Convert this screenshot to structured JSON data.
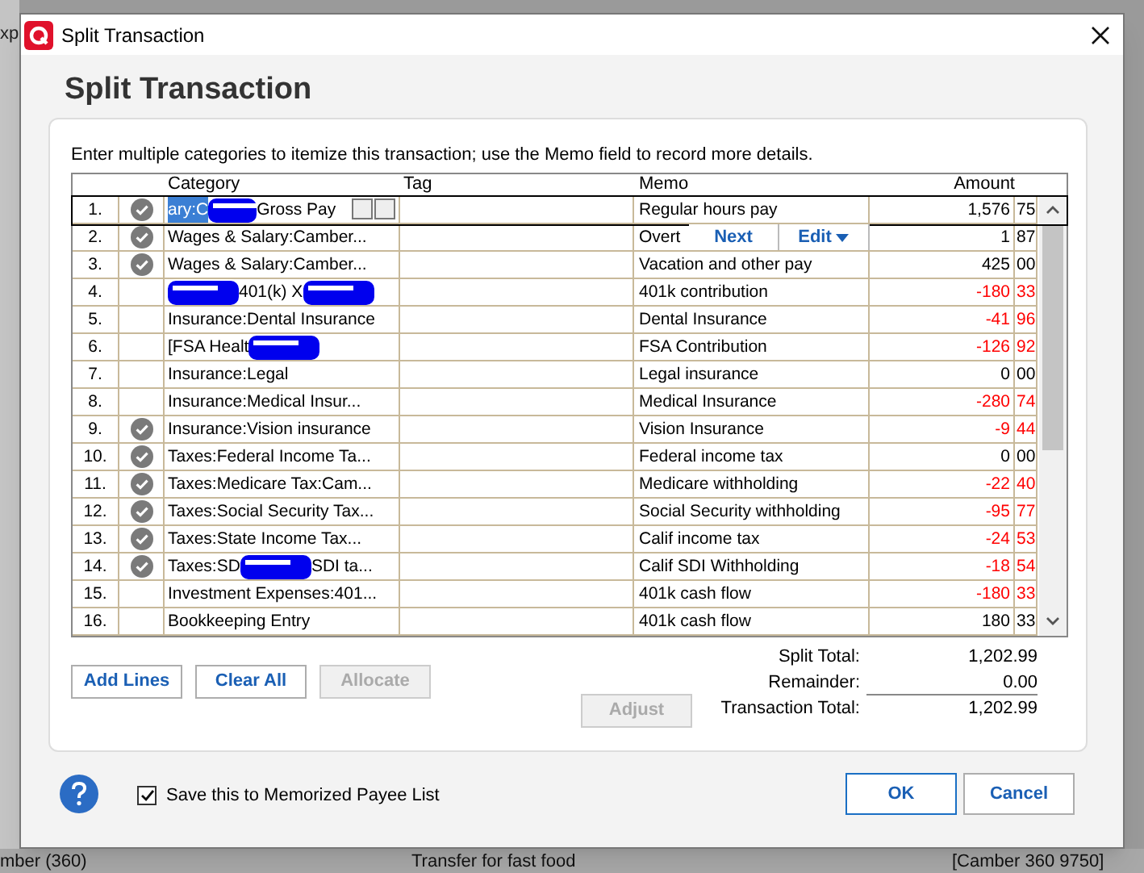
{
  "background": {
    "top_left_text": "xp",
    "bottom_row": [
      "mber (360)",
      "Transfer for fast food",
      "[Camber 360 9750]"
    ]
  },
  "window": {
    "title": "Split Transaction"
  },
  "heading": "Split Transaction",
  "instructions": "Enter multiple categories to itemize this transaction; use the Memo field to record more details.",
  "table": {
    "columns": [
      "Category",
      "Tag",
      "Memo",
      "Amount"
    ],
    "rows": [
      {
        "number": "1.",
        "cleared": true,
        "selected": true,
        "category": [
          {
            "kind": "text",
            "text": "ary:C"
          },
          {
            "kind": "redacted"
          },
          {
            "kind": "text",
            "text": "Gross Pay"
          }
        ],
        "memo": "Regular hours pay",
        "dollars": "1,576",
        "cents": "75",
        "negative": false
      },
      {
        "number": "2.",
        "cleared": true,
        "selected": false,
        "category": [
          {
            "kind": "text",
            "text": "Wages & Salary:Camber..."
          }
        ],
        "memo": "Overt",
        "dollars": "1",
        "cents": "87",
        "negative": false
      },
      {
        "number": "3.",
        "cleared": true,
        "selected": false,
        "category": [
          {
            "kind": "text",
            "text": "Wages & Salary:Camber..."
          }
        ],
        "memo": "Vacation and other pay",
        "dollars": "425",
        "cents": "00",
        "negative": false
      },
      {
        "number": "4.",
        "cleared": false,
        "selected": false,
        "category": [
          {
            "kind": "redacted"
          },
          {
            "kind": "text",
            "text": "401(k) X"
          },
          {
            "kind": "redacted"
          }
        ],
        "memo": "401k contribution",
        "dollars": "-180",
        "cents": "33",
        "negative": true
      },
      {
        "number": "5.",
        "cleared": false,
        "selected": false,
        "category": [
          {
            "kind": "text",
            "text": "Insurance:Dental Insurance"
          }
        ],
        "memo": "Dental Insurance",
        "dollars": "-41",
        "cents": "96",
        "negative": true
      },
      {
        "number": "6.",
        "cleared": false,
        "selected": false,
        "category": [
          {
            "kind": "text",
            "text": "[FSA Healt"
          },
          {
            "kind": "redacted"
          }
        ],
        "memo": "FSA Contribution",
        "dollars": "-126",
        "cents": "92",
        "negative": true
      },
      {
        "number": "7.",
        "cleared": false,
        "selected": false,
        "category": [
          {
            "kind": "text",
            "text": "Insurance:Legal"
          }
        ],
        "memo": "Legal insurance",
        "dollars": "0",
        "cents": "00",
        "negative": false
      },
      {
        "number": "8.",
        "cleared": false,
        "selected": false,
        "category": [
          {
            "kind": "text",
            "text": "Insurance:Medical Insur..."
          }
        ],
        "memo": "Medical Insurance",
        "dollars": "-280",
        "cents": "74",
        "negative": true
      },
      {
        "number": "9.",
        "cleared": true,
        "selected": false,
        "category": [
          {
            "kind": "text",
            "text": "Insurance:Vision insurance"
          }
        ],
        "memo": "Vision Insurance",
        "dollars": "-9",
        "cents": "44",
        "negative": true
      },
      {
        "number": "10.",
        "cleared": true,
        "selected": false,
        "category": [
          {
            "kind": "text",
            "text": "Taxes:Federal Income Ta..."
          }
        ],
        "memo": "Federal income tax",
        "dollars": "0",
        "cents": "00",
        "negative": false
      },
      {
        "number": "11.",
        "cleared": true,
        "selected": false,
        "category": [
          {
            "kind": "text",
            "text": "Taxes:Medicare Tax:Cam..."
          }
        ],
        "memo": "Medicare withholding",
        "dollars": "-22",
        "cents": "40",
        "negative": true
      },
      {
        "number": "12.",
        "cleared": true,
        "selected": false,
        "category": [
          {
            "kind": "text",
            "text": "Taxes:Social Security Tax..."
          }
        ],
        "memo": "Social Security withholding",
        "dollars": "-95",
        "cents": "77",
        "negative": true
      },
      {
        "number": "13.",
        "cleared": true,
        "selected": false,
        "category": [
          {
            "kind": "text",
            "text": "Taxes:State Income Tax..."
          }
        ],
        "memo": "Calif income tax",
        "dollars": "-24",
        "cents": "53",
        "negative": true
      },
      {
        "number": "14.",
        "cleared": true,
        "selected": false,
        "category": [
          {
            "kind": "text",
            "text": "Taxes:SD"
          },
          {
            "kind": "redacted"
          },
          {
            "kind": "text",
            "text": "SDI ta..."
          }
        ],
        "memo": "Calif SDI Withholding",
        "dollars": "-18",
        "cents": "54",
        "negative": true
      },
      {
        "number": "15.",
        "cleared": false,
        "selected": false,
        "category": [
          {
            "kind": "text",
            "text": "Investment Expenses:401..."
          }
        ],
        "memo": "401k cash flow",
        "dollars": "-180",
        "cents": "33",
        "negative": true
      },
      {
        "number": "16.",
        "cleared": false,
        "selected": false,
        "category": [
          {
            "kind": "text",
            "text": "Bookkeeping Entry"
          }
        ],
        "memo": "401k cash flow",
        "dollars": "180",
        "cents": "33",
        "negative": false
      }
    ]
  },
  "row_popup": {
    "buttons": [
      "Next",
      "Edit"
    ]
  },
  "actions": [
    {
      "label": "Add Lines",
      "disabled": false
    },
    {
      "label": "Clear All",
      "disabled": false
    },
    {
      "label": "Allocate",
      "disabled": true
    }
  ],
  "adjust": {
    "label": "Adjust",
    "disabled": true
  },
  "totals": [
    {
      "label": "Split Total:",
      "value": "1,202.99"
    },
    {
      "label": "Remainder:",
      "value": "0.00"
    },
    {
      "label": "Transaction Total:",
      "value": "1,202.99"
    }
  ],
  "memorize": {
    "label": "Save this to Memorized Payee List",
    "checked": true
  },
  "footer_buttons": [
    "OK",
    "Cancel"
  ]
}
